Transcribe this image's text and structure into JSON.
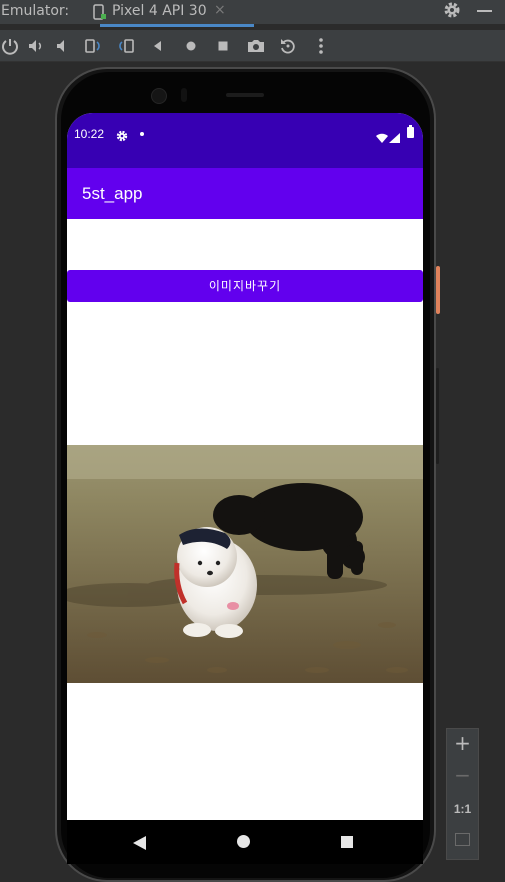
{
  "emulator": {
    "label": "Emulator:",
    "tab_name": "Pixel 4 API 30",
    "tab_close": "×"
  },
  "toolbar": {
    "icons": [
      "power-icon",
      "volume-up-icon",
      "volume-down-icon",
      "rotate-left-icon",
      "rotate-right-icon",
      "back-icon",
      "home-icon",
      "overview-icon",
      "camera-icon",
      "replay-icon",
      "more-icon"
    ]
  },
  "device": {
    "status_time": "10:22",
    "app_title": "5st_app",
    "button_label": "이미지바꾸기",
    "image_alt": "Pomeranian puppy and black poodle on grass"
  },
  "zoom": {
    "plus": "+",
    "minus": "−",
    "one_to_one": "1:1"
  },
  "colors": {
    "status_bar": "#3700b3",
    "app_bar": "#6200ee",
    "button": "#6200ee",
    "ide_background": "#2b2b2b"
  }
}
